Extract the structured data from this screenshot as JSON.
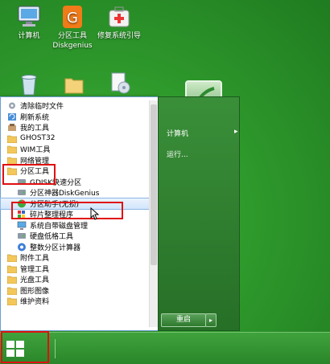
{
  "desktop": {
    "icons": [
      {
        "name": "computer-icon",
        "label": "计算机"
      },
      {
        "name": "partition-tool-icon",
        "label": "分区工具\nDiskgenius"
      },
      {
        "name": "repair-boot-icon",
        "label": "修复系统引导"
      },
      {
        "name": "recycle-bin-icon",
        "label": ""
      },
      {
        "name": "folder-icon",
        "label": ""
      },
      {
        "name": "document-icon",
        "label": ""
      }
    ]
  },
  "start_menu": {
    "items": [
      {
        "label": "清除临时文件",
        "level": 0,
        "icon": "gear-icon"
      },
      {
        "label": "刷新系统",
        "level": 0,
        "icon": "refresh-icon"
      },
      {
        "label": "我的工具",
        "level": 0,
        "icon": "tools-icon"
      },
      {
        "label": "GHOST32",
        "level": 0,
        "icon": "folder-icon"
      },
      {
        "label": "WIM工具",
        "level": 0,
        "icon": "folder-icon"
      },
      {
        "label": "网络管理",
        "level": 0,
        "icon": "folder-icon"
      },
      {
        "label": "分区工具",
        "level": 0,
        "icon": "folder-icon"
      },
      {
        "label": "GDISK快速分区",
        "level": 1,
        "icon": "disk-icon"
      },
      {
        "label": "分区神器DiskGenius",
        "level": 1,
        "icon": "disk-icon"
      },
      {
        "label": "分区助手(无损)",
        "level": 1,
        "icon": "pie-icon"
      },
      {
        "label": "碎片整理程序",
        "level": 1,
        "icon": "defrag-icon"
      },
      {
        "label": "系统自带磁盘管理",
        "level": 1,
        "icon": "computer-icon"
      },
      {
        "label": "硬盘低格工具",
        "level": 1,
        "icon": "disk-icon"
      },
      {
        "label": "整数分区计算器",
        "level": 1,
        "icon": "calc-icon"
      },
      {
        "label": "附件工具",
        "level": 0,
        "icon": "folder-icon"
      },
      {
        "label": "管理工具",
        "level": 0,
        "icon": "folder-icon"
      },
      {
        "label": "光盘工具",
        "level": 0,
        "icon": "folder-icon"
      },
      {
        "label": "图形图像",
        "level": 0,
        "icon": "folder-icon"
      },
      {
        "label": "维护资料",
        "level": 0,
        "icon": "folder-icon"
      }
    ],
    "right": {
      "computer": "计算机",
      "computer_arrow": "▸",
      "run": "运行..."
    },
    "shutdown": "重启",
    "shutdown_arrow": "▸"
  },
  "colors": {
    "highlight_box": "#e01010",
    "accent_green": "#2f9a2c"
  }
}
